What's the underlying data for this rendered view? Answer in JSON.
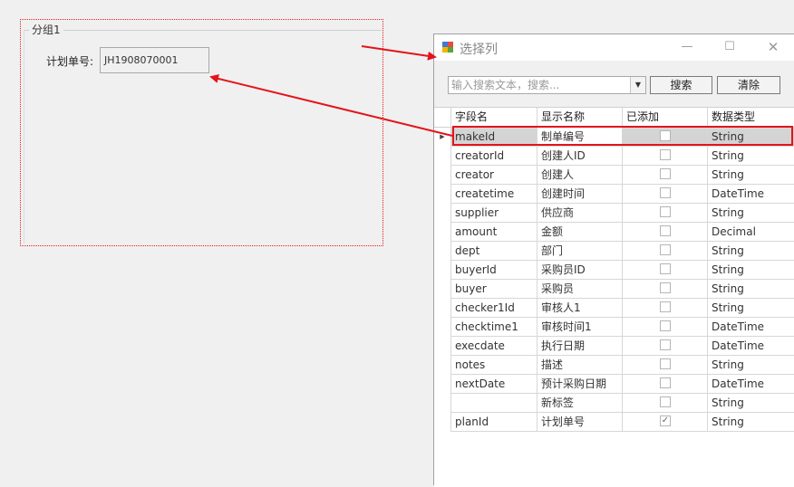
{
  "designer": {
    "group_title": "分组1",
    "field_label": "计划单号:",
    "field_value": "JH1908070001"
  },
  "dialog": {
    "title": "选择列",
    "window_buttons": {
      "minimize": "—",
      "maximize": "☐",
      "close": "✕"
    },
    "search_placeholder": "输入搜索文本，搜索...",
    "search_button": "搜索",
    "clear_button": "清除",
    "columns": [
      "字段名",
      "显示名称",
      "已添加",
      "数据类型"
    ],
    "rows": [
      {
        "field": "makeId",
        "display": "制单编号",
        "added": false,
        "type": "String"
      },
      {
        "field": "creatorId",
        "display": "创建人ID",
        "added": false,
        "type": "String"
      },
      {
        "field": "creator",
        "display": "创建人",
        "added": false,
        "type": "String"
      },
      {
        "field": "createtime",
        "display": "创建时间",
        "added": false,
        "type": "DateTime"
      },
      {
        "field": "supplier",
        "display": "供应商",
        "added": false,
        "type": "String"
      },
      {
        "field": "amount",
        "display": "金额",
        "added": false,
        "type": "Decimal"
      },
      {
        "field": "dept",
        "display": "部门",
        "added": false,
        "type": "String"
      },
      {
        "field": "buyerId",
        "display": "采购员ID",
        "added": false,
        "type": "String"
      },
      {
        "field": "buyer",
        "display": "采购员",
        "added": false,
        "type": "String"
      },
      {
        "field": "checker1Id",
        "display": "审核人1",
        "added": false,
        "type": "String"
      },
      {
        "field": "checktime1",
        "display": "审核时间1",
        "added": false,
        "type": "DateTime"
      },
      {
        "field": "execdate",
        "display": "执行日期",
        "added": false,
        "type": "DateTime"
      },
      {
        "field": "notes",
        "display": "描述",
        "added": false,
        "type": "String"
      },
      {
        "field": "nextDate",
        "display": "预计采购日期",
        "added": false,
        "type": "DateTime"
      },
      {
        "field": "",
        "display": "新标签",
        "added": false,
        "type": "String"
      },
      {
        "field": "planId",
        "display": "计划单号",
        "added": true,
        "type": "String"
      }
    ],
    "selected_row": 0
  },
  "colors": {
    "annotation": "#e4141b"
  },
  "icons": {
    "app": "app-window-icon",
    "row_pointer": "row-pointer-icon",
    "checked": "checkmark-icon"
  }
}
